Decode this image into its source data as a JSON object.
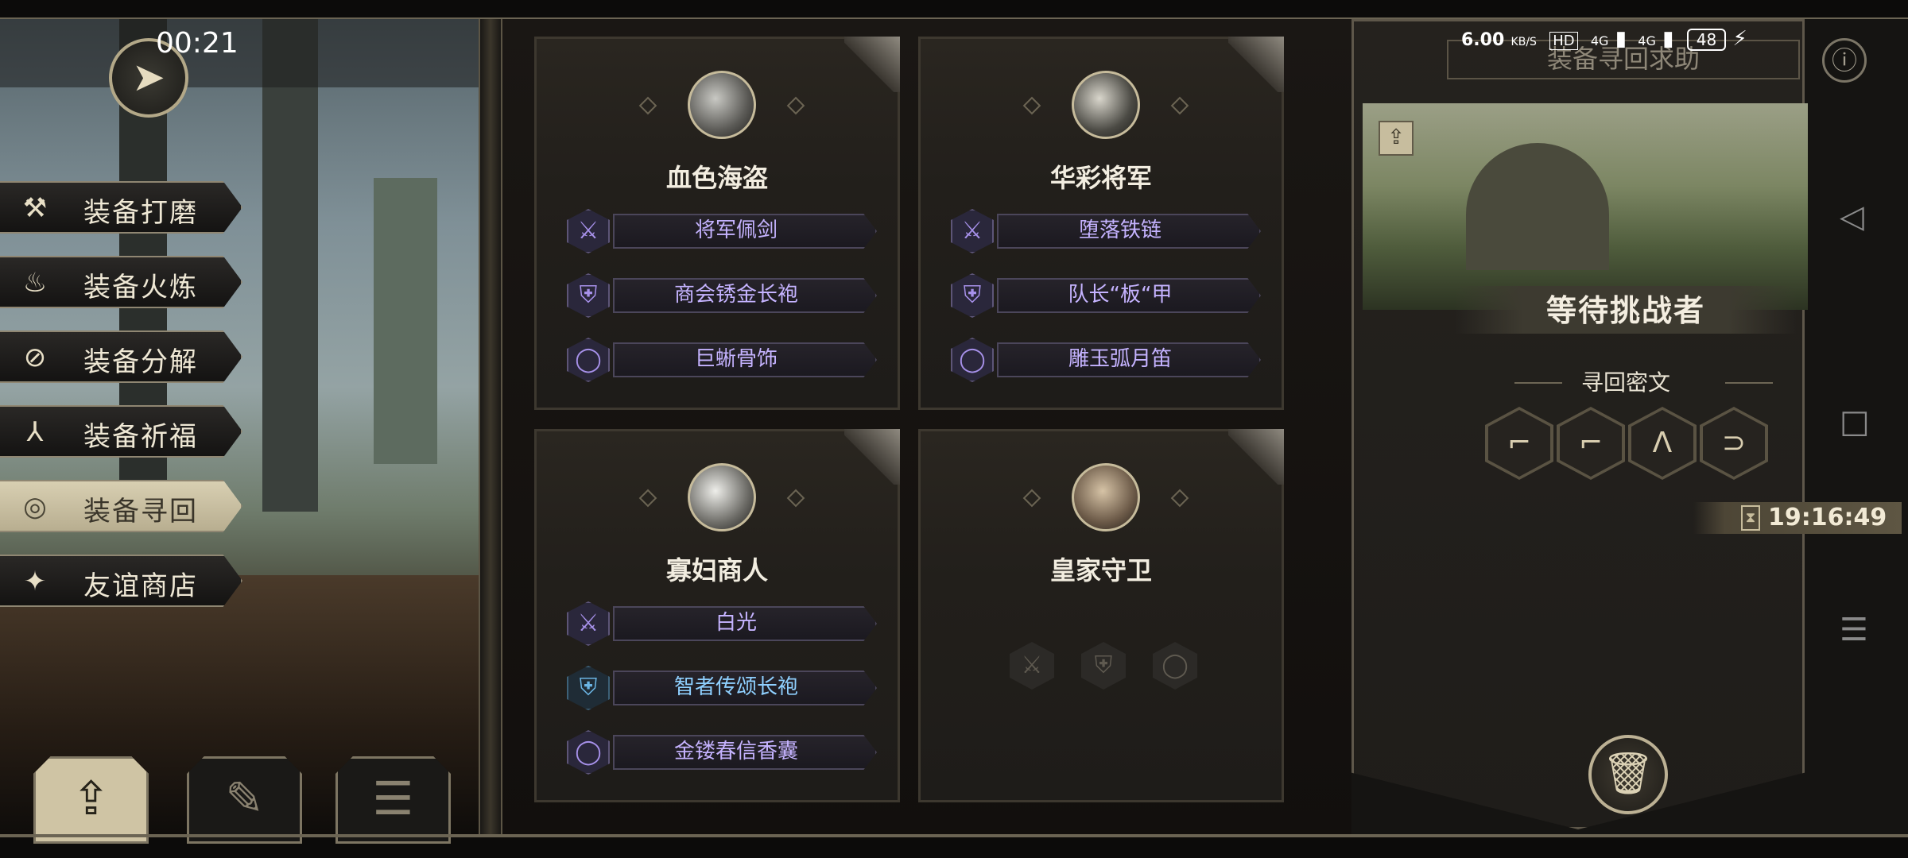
{
  "status_bar": {
    "time": "00:21",
    "net_speed": "6.00",
    "net_unit": "KB/S",
    "hd": "HD",
    "sig1": "4G",
    "sig2": "4G",
    "battery": "48"
  },
  "left_menu": {
    "items": [
      {
        "label": "装备打磨",
        "icon": "hammer-icon"
      },
      {
        "label": "装备火炼",
        "icon": "flame-icon"
      },
      {
        "label": "装备分解",
        "icon": "break-icon"
      },
      {
        "label": "装备祈福",
        "icon": "pray-icon"
      },
      {
        "label": "装备寻回",
        "icon": "retrieve-icon"
      },
      {
        "label": "友谊商店",
        "icon": "fox-icon"
      }
    ],
    "active": "装备寻回"
  },
  "cards": [
    {
      "name": "血色海盗",
      "items": [
        "将军佩剑",
        "商会锈金长袍",
        "巨蜥骨饰"
      ]
    },
    {
      "name": "华彩将军",
      "items": [
        "堕落铁链",
        "队长“板“甲",
        "雕玉弧月笛"
      ]
    },
    {
      "name": "寡妇商人",
      "items": [
        "白光",
        "智者传颂长袍",
        "金镂春信香囊"
      ]
    },
    {
      "name": "皇家守卫",
      "items": []
    }
  ],
  "right_panel": {
    "title": "装备寻回求助",
    "status": "等待挑战者",
    "cipher_label": "寻回密文",
    "timer": "19:16:49"
  },
  "colors": {
    "epic": "#c5b3ff",
    "rare": "#8fd0ff",
    "gold_border": "#b3a888"
  }
}
